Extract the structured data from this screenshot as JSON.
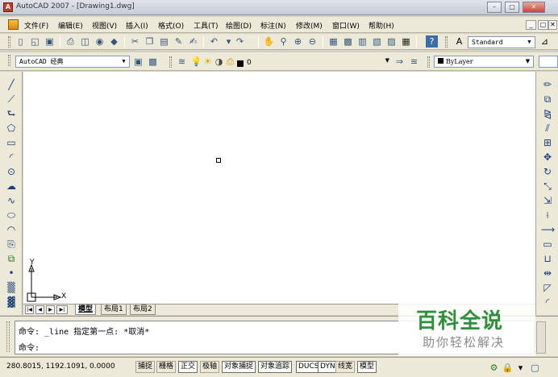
{
  "window": {
    "title": "AutoCAD 2007 - [Drawing1.dwg]",
    "minimize_glyph": "–",
    "maximize_glyph": "▢",
    "close_glyph": "✕"
  },
  "menu": {
    "items": [
      "文件(F)",
      "编辑(E)",
      "视图(V)",
      "插入(I)",
      "格式(O)",
      "工具(T)",
      "绘图(D)",
      "标注(N)",
      "修改(M)",
      "窗口(W)",
      "帮助(H)"
    ],
    "mdi_buttons": [
      "_",
      "▢",
      "✕"
    ]
  },
  "toolbar": {
    "text_style": "Standard",
    "workspace": "AutoCAD 经典",
    "layer": "0",
    "color": "ByLayer"
  },
  "layout_tabs": {
    "nav": [
      "|◀",
      "◀",
      "▶",
      "▶|"
    ],
    "tabs": [
      "模型",
      "布局1",
      "布局2"
    ]
  },
  "ucs": {
    "y_label": "Y",
    "x_label": "X"
  },
  "command": {
    "line1": "命令: _line 指定第一点: *取消*",
    "line2": "命令:"
  },
  "status": {
    "coords": "280.8015, 1192.1091, 0.0000",
    "toggles": [
      "捕捉",
      "栅格",
      "正交",
      "极轴",
      "对象捕捉",
      "对象追踪",
      "DUCS",
      "DYN",
      "线宽",
      "模型"
    ],
    "active": [
      "正交",
      "对象捕捉",
      "对象追踪",
      "DUCS",
      "DYN",
      "模型"
    ]
  },
  "watermark": {
    "title": "百科全说",
    "subtitle": "助你轻松解决"
  },
  "colors": {
    "canvas": "#ffffff",
    "chrome": "#ece9d8",
    "accent": "#2f8f3a"
  }
}
